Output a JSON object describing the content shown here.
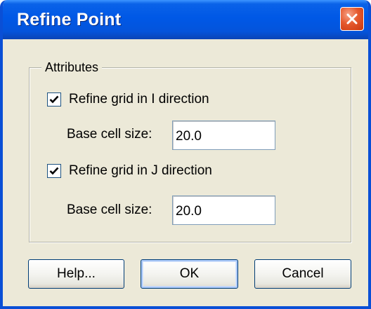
{
  "window": {
    "title": "Refine Point",
    "close_icon": "close-icon",
    "colors": {
      "titlebar": "#0058e6",
      "close": "#e5582d",
      "body": "#ece9d8"
    }
  },
  "attributes": {
    "legend": "Attributes",
    "refine_i": {
      "label": "Refine grid in I direction",
      "checked": true
    },
    "base_cell_i": {
      "label": "Base cell size:",
      "value": "20.0"
    },
    "refine_j": {
      "label": "Refine grid in J direction",
      "checked": true
    },
    "base_cell_j": {
      "label": "Base cell size:",
      "value": "20.0"
    }
  },
  "buttons": {
    "help": "Help...",
    "ok": "OK",
    "cancel": "Cancel"
  }
}
